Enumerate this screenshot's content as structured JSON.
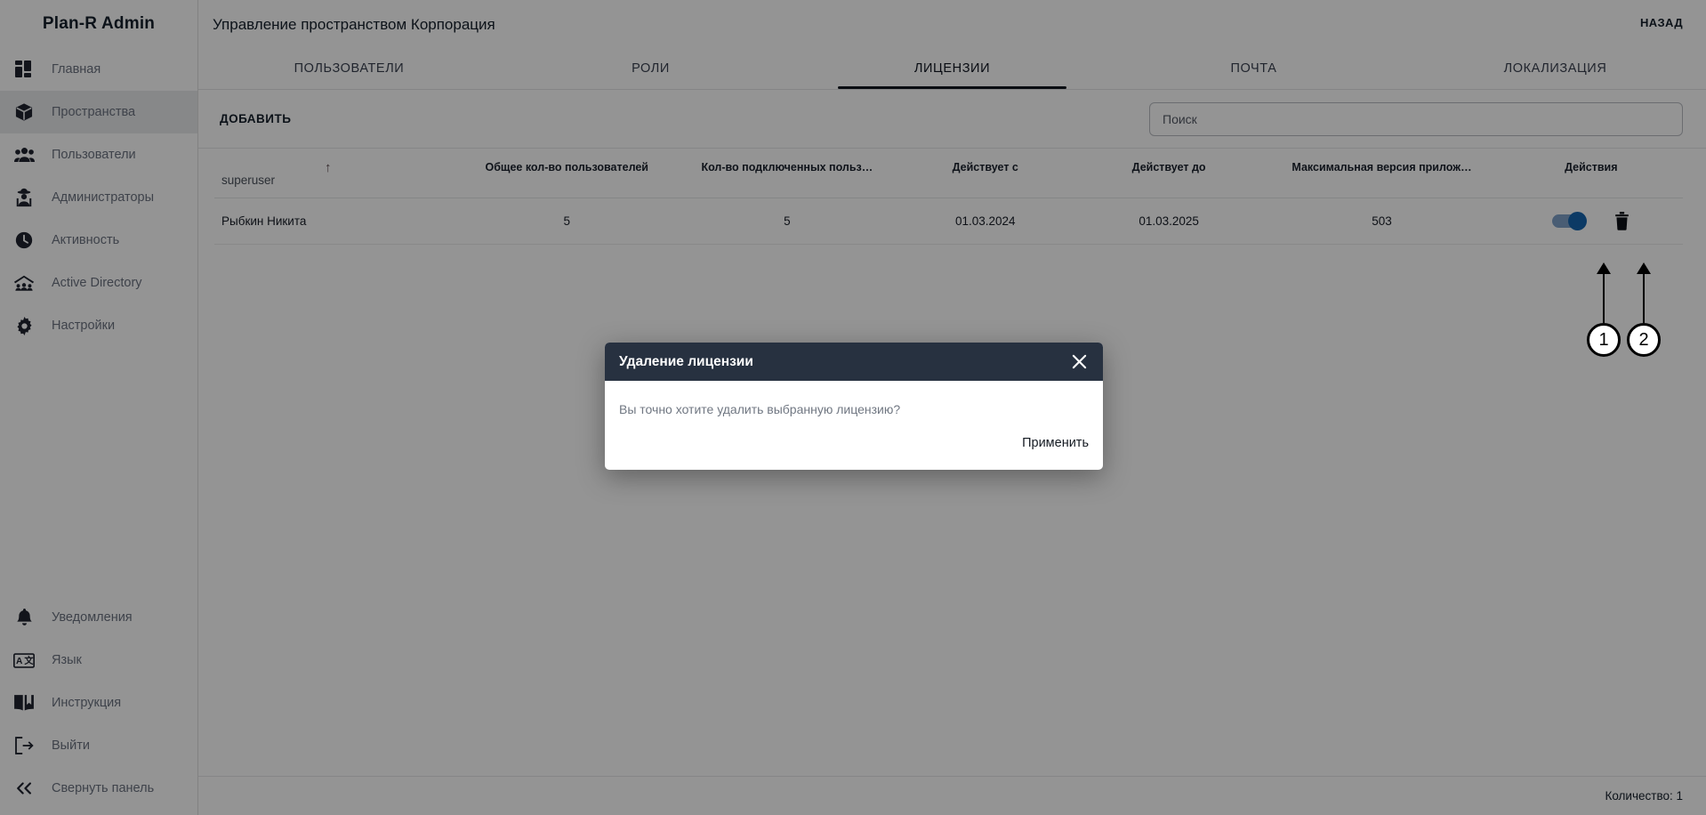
{
  "app": {
    "brand": "Plan-R Admin"
  },
  "sidebar": {
    "top_items": [
      {
        "label": "Главная",
        "icon": "dashboard-icon",
        "active": false
      },
      {
        "label": "Пространства",
        "icon": "cube-icon",
        "active": true
      },
      {
        "label": "Пользователи",
        "icon": "users-icon",
        "active": false
      },
      {
        "label": "Администраторы",
        "icon": "admin-icon",
        "active": false
      },
      {
        "label": "Активность",
        "icon": "clock-icon",
        "active": false
      },
      {
        "label": "Active Directory",
        "icon": "directory-icon",
        "active": false
      },
      {
        "label": "Настройки",
        "icon": "gear-icon",
        "active": false
      }
    ],
    "bottom_items": [
      {
        "label": "Уведомления",
        "icon": "bell-icon"
      },
      {
        "label": "Язык",
        "icon": "language-icon"
      },
      {
        "label": "Инструкция",
        "icon": "book-icon"
      },
      {
        "label": "Выйти",
        "icon": "logout-icon"
      },
      {
        "label": "Свернуть панель",
        "icon": "chevron-double-left-icon"
      }
    ]
  },
  "header": {
    "title": "Управление пространством Корпорация",
    "back_label": "НАЗАД"
  },
  "tabs": [
    {
      "label": "ПОЛЬЗОВАТЕЛИ",
      "active": false
    },
    {
      "label": "РОЛИ",
      "active": false
    },
    {
      "label": "ЛИЦЕНЗИИ",
      "active": true
    },
    {
      "label": "ПОЧТА",
      "active": false
    },
    {
      "label": "ЛОКАЛИЗАЦИЯ",
      "active": false
    }
  ],
  "toolbar": {
    "add_label": "ДОБАВИТЬ",
    "search_placeholder": "Поиск",
    "search_value": ""
  },
  "table": {
    "sort_column_label": "superuser",
    "sort_direction": "ascending",
    "sort_arrow_glyph": "↑",
    "columns": [
      "superuser",
      "Общее кол-во пользователей",
      "Кол-во подключенных польз…",
      "Действует с",
      "Действует до",
      "Максимальная версия прилож…",
      "Действия"
    ],
    "rows": [
      {
        "name": "Рыбкин Никита",
        "total_users": "5",
        "connected_users": "5",
        "valid_from": "01.03.2024",
        "valid_to": "01.03.2025",
        "max_app_version": "503",
        "toggle_on": true
      }
    ],
    "footer_count": "Количество: 1"
  },
  "modal": {
    "title": "Удаление лицензии",
    "close_glyph": "✕",
    "message": "Вы точно хотите удалить выбранную лицензию?",
    "apply_label": "Применить"
  },
  "annotations": [
    {
      "number": "1",
      "target": "license-toggle"
    },
    {
      "number": "2",
      "target": "delete-license-icon"
    }
  ],
  "colors": {
    "accent_toggle": "#1665ae",
    "modal_header": "#273140",
    "active_nav": "#e9eaec",
    "tab_underline": "#111820"
  }
}
